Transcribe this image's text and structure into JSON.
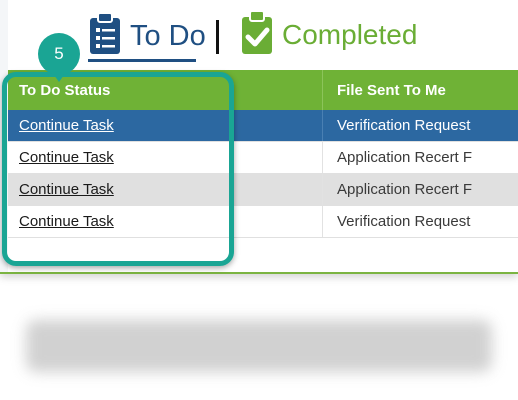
{
  "tabs": {
    "todo_label": "To Do",
    "completed_label": "Completed",
    "todo_icon": "clipboard-list-icon",
    "completed_icon": "clipboard-check-icon"
  },
  "table": {
    "columns": [
      "To Do Status",
      "File Sent To Me"
    ],
    "rows": [
      {
        "status": "Continue Task",
        "file": "Verification Request"
      },
      {
        "status": "Continue Task",
        "file": "Application Recert F"
      },
      {
        "status": "Continue Task",
        "file": "Application Recert F"
      },
      {
        "status": "Continue Task",
        "file": "Verification Request"
      }
    ]
  },
  "callout": {
    "number": "5"
  },
  "colors": {
    "header_green": "#6fb236",
    "todo_blue": "#1f4f82",
    "completed_green": "#6aad35",
    "selected_row": "#2c68a1",
    "shaded_row": "#e0e0e0",
    "callout_teal": "#1aa594"
  }
}
